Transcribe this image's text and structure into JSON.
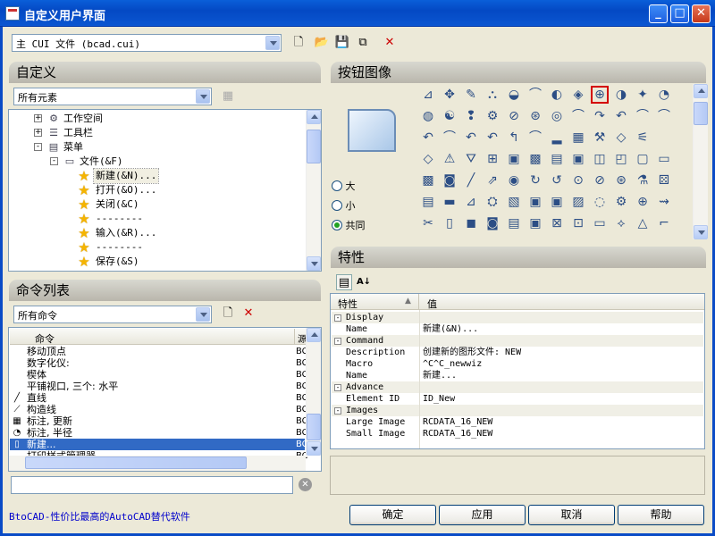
{
  "window": {
    "title": "自定义用户界面"
  },
  "top_toolbar": {
    "cui_file": "主 CUI 文件 (bcad.cui)"
  },
  "customize": {
    "header": "自定义",
    "filter": "所有元素",
    "tree": [
      {
        "label": "工作空间",
        "level": 1,
        "toggle": "+",
        "icon": "gear-icon"
      },
      {
        "label": "工具栏",
        "level": 1,
        "toggle": "+",
        "icon": "toolbar-icon"
      },
      {
        "label": "菜单",
        "level": 1,
        "toggle": "-",
        "icon": "menu-icon"
      },
      {
        "label": "文件(&F)",
        "level": 2,
        "toggle": "-",
        "icon": "file-menu-icon"
      },
      {
        "label": "新建(&N)...",
        "level": 3,
        "icon": "star-icon",
        "selected": true
      },
      {
        "label": "打开(&O)...",
        "level": 3,
        "icon": "star-icon"
      },
      {
        "label": "关闭(&C)",
        "level": 3,
        "icon": "star-icon"
      },
      {
        "label": "--------",
        "level": 3,
        "icon": "star-icon"
      },
      {
        "label": "输入(&R)...",
        "level": 3,
        "icon": "star-icon"
      },
      {
        "label": "--------",
        "level": 3,
        "icon": "star-icon"
      },
      {
        "label": "保存(&S)",
        "level": 3,
        "icon": "star-icon"
      }
    ]
  },
  "commands": {
    "header": "命令列表",
    "filter": "所有命令",
    "column_command": "命令",
    "column_source": "源",
    "rows": [
      {
        "icon": "",
        "label": "移动顶点",
        "src": "BC"
      },
      {
        "icon": "",
        "label": "数字化仪:",
        "src": "BC"
      },
      {
        "icon": "",
        "label": "楔体",
        "src": "BC"
      },
      {
        "icon": "",
        "label": "平铺视口, 三个: 水平",
        "src": "BC"
      },
      {
        "icon": "╱",
        "label": "直线",
        "src": "BC"
      },
      {
        "icon": "⟋",
        "label": "构造线",
        "src": "BC"
      },
      {
        "icon": "▦",
        "label": "标注, 更新",
        "src": "BC"
      },
      {
        "icon": "◔",
        "label": "标注, 半径",
        "src": "BC"
      },
      {
        "icon": "▯",
        "label": "新建...",
        "src": "BC",
        "selected": true
      },
      {
        "icon": "",
        "label": "打印样式管理器",
        "src": "BC"
      }
    ],
    "search_value": ""
  },
  "button_image": {
    "header": "按钮图像",
    "size_large": "大",
    "size_small": "小",
    "size_both": "共同",
    "selected_size": "共同",
    "grid_rows": [
      [
        "⊿",
        "✥",
        "✎",
        "⛬",
        "◒",
        "⌒",
        "◐",
        "◈",
        "⊕",
        "◑",
        "✦",
        "◔"
      ],
      [
        "◍",
        "☯",
        "❢",
        "⚙",
        "⊘",
        "⊛",
        "◎",
        "⌒",
        "↷",
        "↶",
        "⌒",
        "⌒"
      ],
      [
        "↶",
        "⌒",
        "↶",
        "↶",
        "↰",
        "⌒",
        "▂",
        "▦",
        "⚒",
        "◇",
        "⚟",
        ""
      ],
      [
        "◇",
        "⚠",
        "⛛",
        "⊞",
        "▣",
        "▩",
        "▤",
        "▣",
        "◫",
        "◰",
        "▢",
        "▭"
      ],
      [
        "▩",
        "◙",
        "╱",
        "⇗",
        "◉",
        "↻",
        "↺",
        "⊙",
        "⊘",
        "⊛",
        "⚗",
        "⚄"
      ],
      [
        "▤",
        "▬",
        "⊿",
        "⛭",
        "▧",
        "▣",
        "▣",
        "▨",
        "◌",
        "⚙",
        "⊕",
        "⇝"
      ],
      [
        "✂",
        "▯",
        "◼",
        "◙",
        "▤",
        "▣",
        "⊠",
        "⊡",
        "▭",
        "⟡",
        "△",
        "⌐"
      ]
    ]
  },
  "properties": {
    "header": "特性",
    "col_property": "特性",
    "col_value": "值",
    "rows": [
      {
        "type": "cat",
        "key": "Display"
      },
      {
        "type": "prop",
        "key": "Name",
        "value": "新建(&N)..."
      },
      {
        "type": "cat",
        "key": "Command"
      },
      {
        "type": "prop",
        "key": "Description",
        "value": "创建新的图形文件:   NEW"
      },
      {
        "type": "prop",
        "key": "Macro",
        "value": "^C^C_newwiz"
      },
      {
        "type": "prop",
        "key": "Name",
        "value": "新建..."
      },
      {
        "type": "cat",
        "key": "Advance"
      },
      {
        "type": "prop",
        "key": "Element ID",
        "value": "ID_New"
      },
      {
        "type": "cat",
        "key": "Images"
      },
      {
        "type": "prop",
        "key": "Large Image",
        "value": "RCDATA_16_NEW"
      },
      {
        "type": "prop",
        "key": "Small Image",
        "value": "RCDATA_16_NEW"
      }
    ]
  },
  "footer": {
    "brand_text": "BtoCAD-性价比最高的AutoCAD替代软件",
    "ok": "确定",
    "apply": "应用",
    "cancel": "取消",
    "help": "帮助",
    "brand_color": "#0000CC"
  }
}
